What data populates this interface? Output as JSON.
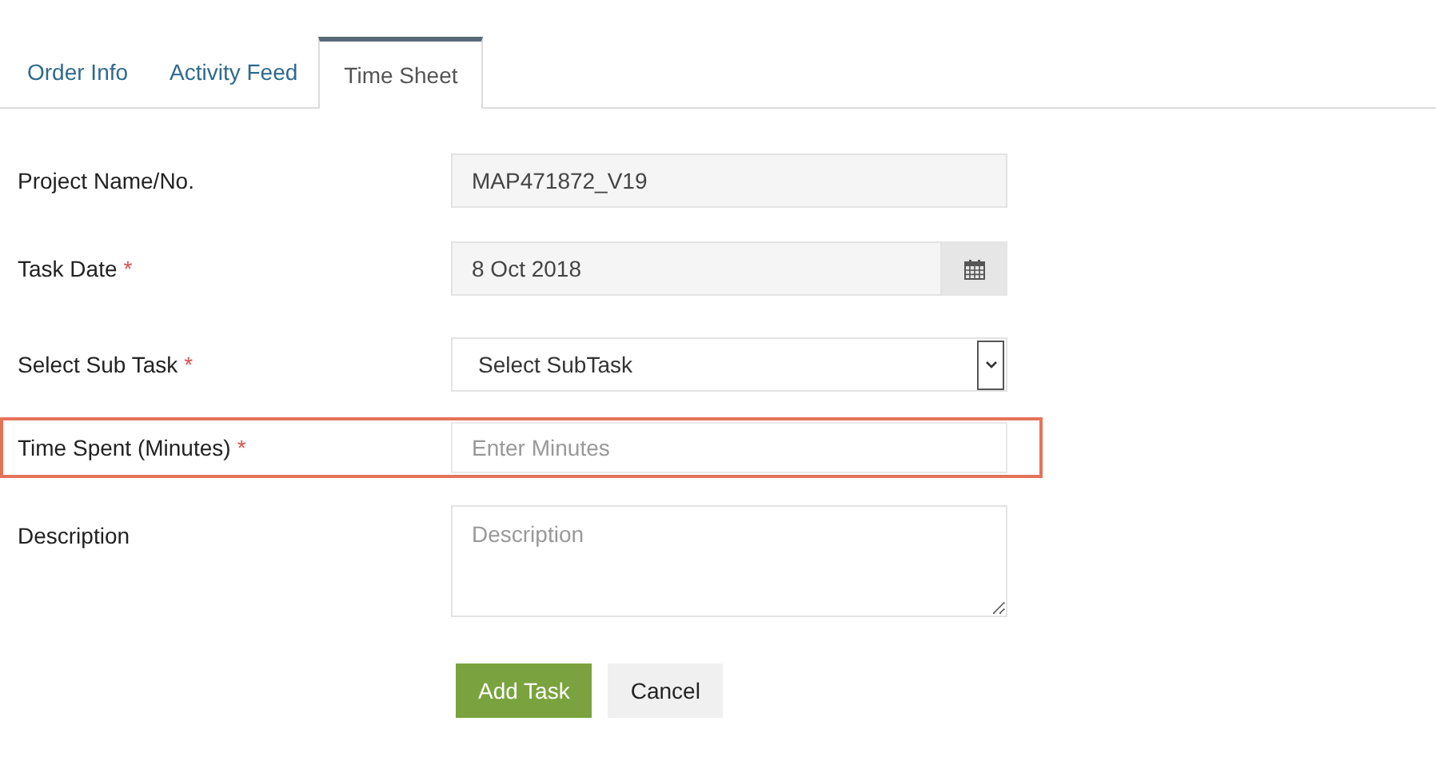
{
  "tabs": [
    {
      "label": "Order Info",
      "selected": false
    },
    {
      "label": "Activity Feed",
      "selected": false
    },
    {
      "label": "Time Sheet",
      "selected": true
    }
  ],
  "fields": [
    {
      "kind": "readonly",
      "label": "Project Name/No.",
      "value": "MAP471872_V19",
      "highlighted": false
    },
    {
      "kind": "date",
      "label": "Task Date",
      "required_mark": "*",
      "value": "8 Oct 2018",
      "highlighted": false
    },
    {
      "kind": "select",
      "label": "Select Sub Task",
      "required_mark": "*",
      "value": "Select SubTask",
      "highlighted": false
    },
    {
      "kind": "input",
      "label": "Time Spent (Minutes)",
      "required_mark": "*",
      "placeholder": "Enter Minutes",
      "highlighted": true
    },
    {
      "kind": "textarea",
      "label": "Description",
      "placeholder": "Description",
      "highlighted": false
    }
  ],
  "buttons": [
    {
      "label": "Add Task",
      "kind": "primary"
    },
    {
      "label": "Cancel",
      "kind": "secondary"
    }
  ]
}
